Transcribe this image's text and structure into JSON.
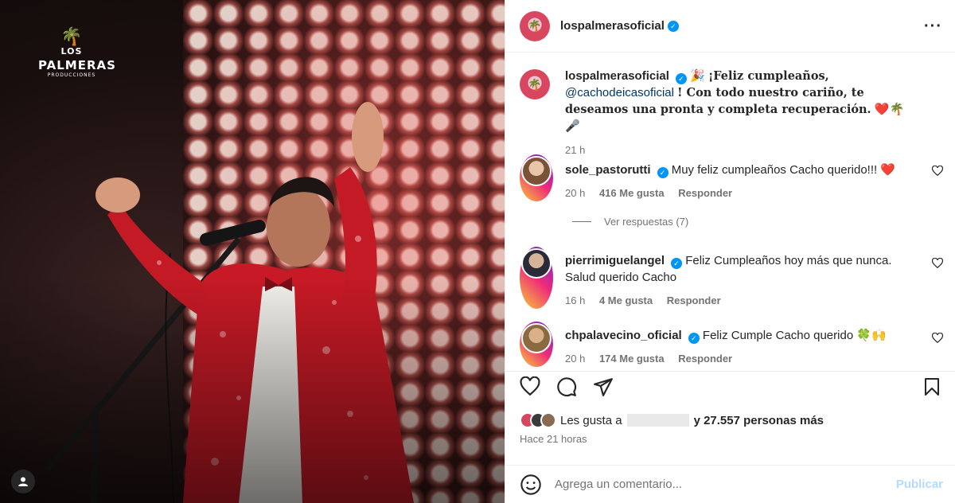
{
  "photo": {
    "logo": {
      "top": "LOS",
      "name": "PALMERAS",
      "sub": "PRODUCCIONES"
    },
    "tag_icon": "person-tag-icon"
  },
  "header": {
    "username": "lospalmerasoficial",
    "more_icon": "more-options-icon"
  },
  "caption": {
    "username": "lospalmerasoficial",
    "emoji_party": "🎉",
    "text1": "¡Feliz cumpleaños,",
    "mention": "@cachodeicasoficial",
    "text2": "! Con todo nuestro cariño, te deseamos una pronta y completa recuperación.",
    "emojis": "❤️🌴🎤",
    "time": "21 h"
  },
  "comments": [
    {
      "username": "sole_pastorutti",
      "text": "Muy feliz cumpleaños Cacho querido!!! ❤️",
      "time": "20 h",
      "likes": "416 Me gusta",
      "reply": "Responder"
    },
    {
      "username": "pierrimiguelangel",
      "text": "Feliz Cumpleaños hoy más que nunca. Salud querido Cacho",
      "time": "16 h",
      "likes": "4 Me gusta",
      "reply": "Responder"
    },
    {
      "username": "chpalavecino_oficial",
      "text": "Feliz Cumple Cacho querido 🍀🙌",
      "time": "20 h",
      "likes": "174 Me gusta",
      "reply": "Responder"
    }
  ],
  "view_replies": "Ver respuestas (7)",
  "actions": {
    "like_icon": "heart-icon",
    "comment_icon": "comment-icon",
    "share_icon": "send-icon",
    "save_icon": "bookmark-icon"
  },
  "likes": {
    "prefix": "Les gusta a",
    "suffix": "y 27.557 personas más"
  },
  "posted": "Hace 21 horas",
  "composer": {
    "placeholder": "Agrega un comentario...",
    "post": "Publicar"
  },
  "colors": {
    "verified": "#0095f6",
    "link": "#00376b",
    "muted": "#737373",
    "post_disabled": "#b3dbff"
  }
}
